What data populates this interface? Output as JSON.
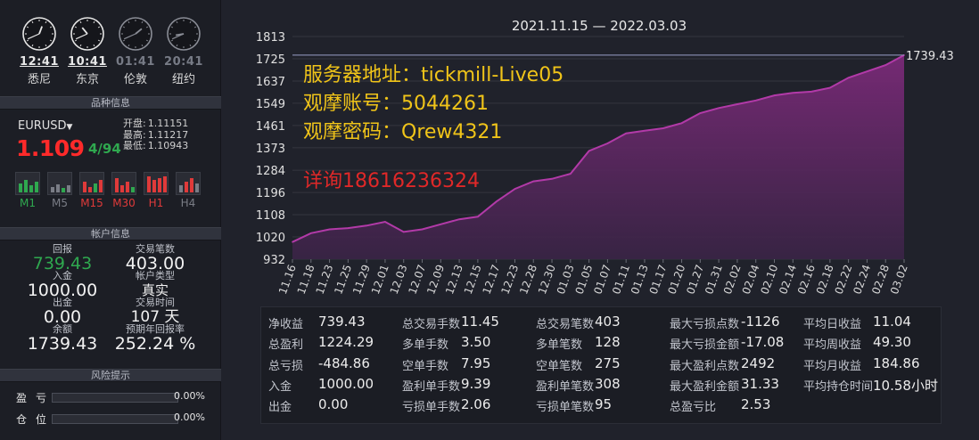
{
  "clocks": [
    {
      "time": "12:41",
      "city": "悉尼",
      "active": true,
      "hour": 12,
      "minute": 41
    },
    {
      "time": "10:41",
      "city": "东京",
      "active": true,
      "hour": 10,
      "minute": 41
    },
    {
      "time": "01:41",
      "city": "伦敦",
      "active": false,
      "hour": 1,
      "minute": 41
    },
    {
      "time": "20:41",
      "city": "纽约",
      "active": false,
      "hour": 20,
      "minute": 41
    }
  ],
  "sections": {
    "symbol_info": "品种信息",
    "account_info": "帐户信息",
    "risk_info": "风险提示"
  },
  "symbol": {
    "name": "EURUSD",
    "price_main": "1.109",
    "price_frac": "4/94",
    "open_label": "开盘:",
    "open": "1.11151",
    "high_label": "最高:",
    "high": "1.11217",
    "low_label": "最低:",
    "low": "1.10943"
  },
  "timeframes": [
    {
      "label": "M1",
      "color": "#2fa84f"
    },
    {
      "label": "M5",
      "color": "#7a7d86"
    },
    {
      "label": "M15",
      "color": "#e03a3a"
    },
    {
      "label": "M30",
      "color": "#e03a3a"
    },
    {
      "label": "H1",
      "color": "#e03a3a"
    },
    {
      "label": "H4",
      "color": "#7a7d86"
    }
  ],
  "account": {
    "return_label": "回报",
    "return_value": "739.43",
    "trades_label": "交易笔数",
    "trades_value": "403.00",
    "deposit_label": "入金",
    "deposit_value": "1000.00",
    "acct_type_label": "帐户类型",
    "acct_type_value": "真实",
    "withdraw_label": "出金",
    "withdraw_value": "0.00",
    "trade_time_label": "交易时间",
    "trade_time_value": "107 天",
    "balance_label": "余额",
    "balance_value": "1739.43",
    "annual_label": "预期年回报率",
    "annual_value": "252.24 %"
  },
  "risk": [
    {
      "label": "盈亏",
      "value": "0.00%",
      "fraction": 0.0
    },
    {
      "label": "仓位",
      "value": "0.00%",
      "fraction": 0.0
    }
  ],
  "watermark": {
    "line1": "服务器地址：tickmill-Live05",
    "line2": "观摩账号：5044261",
    "line3": "观摩密码：Qrew4321",
    "line4": "详询18616236324"
  },
  "chart_data": {
    "type": "area",
    "title": "2021.11.15 — 2022.03.03",
    "last_value_label": "1739.43",
    "ylim": [
      932,
      1813
    ],
    "yticks": [
      932,
      1020,
      1108,
      1196,
      1284,
      1373,
      1461,
      1549,
      1637,
      1725,
      1813
    ],
    "categories": [
      "11.16",
      "11.18",
      "11.23",
      "11.25",
      "11.29",
      "12.01",
      "12.03",
      "12.07",
      "12.09",
      "12.13",
      "12.15",
      "12.17",
      "12.23",
      "12.28",
      "12.30",
      "01.03",
      "01.05",
      "01.07",
      "01.11",
      "01.13",
      "01.17",
      "01.20",
      "01.27",
      "01.31",
      "02.02",
      "02.04",
      "02.10",
      "02.14",
      "02.16",
      "02.18",
      "02.22",
      "02.24",
      "02.28",
      "03.02"
    ],
    "values": [
      1000,
      1035,
      1050,
      1055,
      1065,
      1080,
      1040,
      1050,
      1070,
      1090,
      1100,
      1160,
      1210,
      1240,
      1250,
      1270,
      1360,
      1390,
      1430,
      1440,
      1450,
      1470,
      1510,
      1530,
      1545,
      1560,
      1580,
      1590,
      1595,
      1610,
      1650,
      1675,
      1700,
      1739.43
    ],
    "color": "#b23aa8",
    "grid": true
  },
  "stats": [
    [
      {
        "k": "净收益",
        "v": "739.43"
      },
      {
        "k": "总盈利",
        "v": "1224.29"
      },
      {
        "k": "总亏损",
        "v": "-484.86"
      },
      {
        "k": "入金",
        "v": "1000.00"
      },
      {
        "k": "出金",
        "v": "0.00"
      }
    ],
    [
      {
        "k": "总交易手数",
        "v": "11.45"
      },
      {
        "k": "多单手数",
        "v": "3.50"
      },
      {
        "k": "空单手数",
        "v": "7.95"
      },
      {
        "k": "盈利单手数",
        "v": "9.39"
      },
      {
        "k": "亏损单手数",
        "v": "2.06"
      }
    ],
    [
      {
        "k": "总交易笔数",
        "v": "403"
      },
      {
        "k": "多单笔数",
        "v": "128"
      },
      {
        "k": "空单笔数",
        "v": "275"
      },
      {
        "k": "盈利单笔数",
        "v": "308"
      },
      {
        "k": "亏损单笔数",
        "v": "95"
      }
    ],
    [
      {
        "k": "最大亏损点数",
        "v": "-1126"
      },
      {
        "k": "最大亏损金额",
        "v": "-17.08"
      },
      {
        "k": "最大盈利点数",
        "v": "2492"
      },
      {
        "k": "最大盈利金额",
        "v": "31.33"
      },
      {
        "k": "总盈亏比",
        "v": "2.53"
      }
    ],
    [
      {
        "k": "平均日收益",
        "v": "11.04"
      },
      {
        "k": "平均周收益",
        "v": "49.30"
      },
      {
        "k": "平均月收益",
        "v": "184.86"
      },
      {
        "k": "平均持仓时间",
        "v": "10.58小时"
      },
      {
        "k": "",
        "v": ""
      }
    ]
  ]
}
